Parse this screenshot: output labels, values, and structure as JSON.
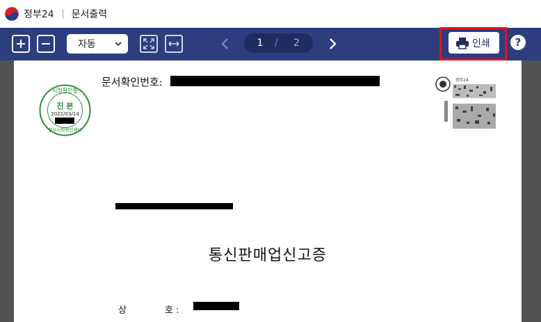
{
  "window": {
    "app_name": "정부24",
    "doc_title": "문서출력"
  },
  "toolbar": {
    "zoom_in": "+",
    "zoom_out": "−",
    "zoom_select": "자동",
    "page_current": "1",
    "page_separator": "/",
    "page_total": "2",
    "print_label": "인쇄",
    "help_label": "?"
  },
  "document": {
    "doc_number_label": "문서확인번호:",
    "seal": {
      "top_text": "시청확인필",
      "center_text": "진 본",
      "date": "2022/03/14",
      "bottom_text": "정부시청확인센터"
    },
    "qr_label": "정부24",
    "title": "통신판매업신고증",
    "field_labels": [
      "상",
      "호 :"
    ]
  },
  "colors": {
    "toolbar_bg": "#2c3e7d",
    "pager_bg": "#1e2c5f",
    "highlight": "#e5141e",
    "seal_green": "#2e8b3a",
    "viewer_bg": "#525252"
  }
}
